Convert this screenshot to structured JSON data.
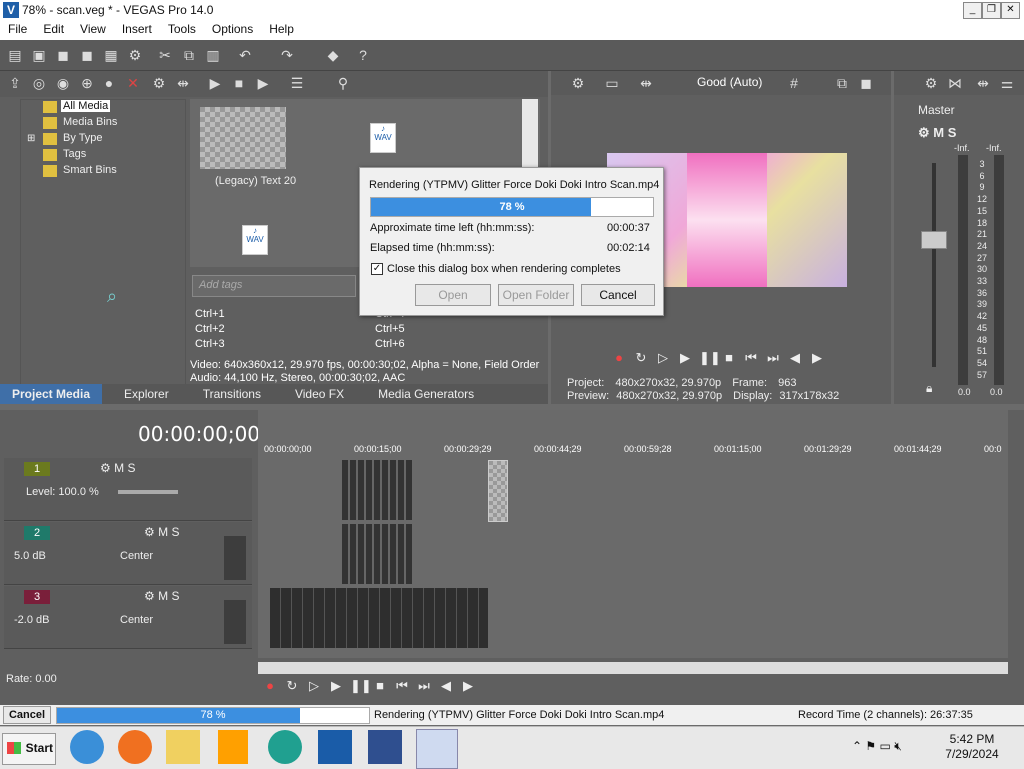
{
  "window": {
    "title": "78% - scan.veg * - VEGAS Pro 14.0",
    "min": "_",
    "max": "❐",
    "close": "✕"
  },
  "menu": [
    "File",
    "Edit",
    "View",
    "Insert",
    "Tools",
    "Options",
    "Help"
  ],
  "media_tree": [
    "All Media",
    "Media Bins",
    "By Type",
    "Tags",
    "Smart Bins"
  ],
  "media_items": {
    "text20": "(Legacy) Text 20",
    "wav": "WAV"
  },
  "tags": {
    "placeholder": "Add tags",
    "shortcuts": [
      "Ctrl+1",
      "Ctrl+2",
      "Ctrl+3",
      "Ctrl+4",
      "Ctrl+5",
      "Ctrl+6"
    ]
  },
  "media_info": {
    "video": "Video: 640x360x12, 29.970 fps, 00:00:30;02, Alpha = None, Field Order",
    "audio": "Audio: 44,100 Hz, Stereo, 00:00:30;02, AAC"
  },
  "tabs": [
    "Project Media",
    "Explorer",
    "Transitions",
    "Video FX",
    "Media Generators"
  ],
  "preview": {
    "quality": "Good (Auto)",
    "project_label": "Project:",
    "project_value": "480x270x32, 29.970p",
    "preview_label": "Preview:",
    "preview_value": "480x270x32, 29.970p",
    "frame_label": "Frame:",
    "frame_value": "963",
    "display_label": "Display:",
    "display_value": "317x178x32"
  },
  "master": {
    "title": "Master",
    "inf_left": "-Inf.",
    "inf_right": "-Inf.",
    "scale": [
      "3",
      "6",
      "9",
      "12",
      "15",
      "18",
      "21",
      "24",
      "27",
      "30",
      "33",
      "36",
      "39",
      "42",
      "45",
      "48",
      "51",
      "54",
      "57"
    ],
    "val_left": "0.0",
    "val_right": "0.0"
  },
  "render_dialog": {
    "title": "Rendering (YTPMV) Glitter Force Doki Doki Intro Scan.mp4",
    "progress_text": "78 %",
    "progress": 0.78,
    "time_left_label": "Approximate time left (hh:mm:ss):",
    "time_left_value": "00:00:37",
    "elapsed_label": "Elapsed time (hh:mm:ss):",
    "elapsed_value": "00:02:14",
    "close_checkbox": "Close this dialog box when rendering completes",
    "open": "Open",
    "open_folder": "Open Folder",
    "cancel": "Cancel"
  },
  "timeline": {
    "timecode": "00:00:00;00",
    "ruler": [
      "00:00:00;00",
      "00:00:15;00",
      "00:00:29;29",
      "00:00:44;29",
      "00:00:59;28",
      "00:01:15;00",
      "00:01:29;29",
      "00:01:44;29",
      "00:0"
    ]
  },
  "tracks": [
    {
      "num": "1",
      "label": "Level: 100.0 %",
      "color": "#6b7a1e"
    },
    {
      "num": "2",
      "label": "5.0 dB",
      "pan": "Center",
      "color": "#1f7a6a"
    },
    {
      "num": "3",
      "label": "-2.0 dB",
      "pan": "Center",
      "color": "#7a1f3a"
    }
  ],
  "track_meter": [
    "-Inf.",
    "12",
    "24",
    "36",
    "48"
  ],
  "rate": "Rate: 0.00",
  "status": {
    "cancel": "Cancel",
    "progress_text": "78 %",
    "progress": 0.78,
    "message": "Rendering (YTPMV) Glitter Force Doki Doki Intro Scan.mp4",
    "record_time": "Record Time (2 channels): 26:37:35"
  },
  "taskbar": {
    "start": "Start",
    "time": "5:42 PM",
    "date": "7/29/2024"
  },
  "colors": {
    "accent_blue": "#3c8fe0",
    "track1": "#6b7a1e",
    "track2": "#1f7a6a",
    "track3": "#7a1f3a"
  }
}
